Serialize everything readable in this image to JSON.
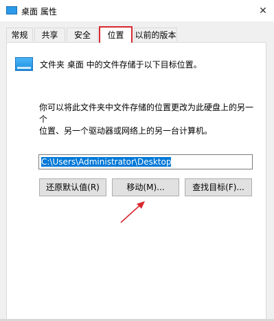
{
  "window": {
    "title": "桌面 属性",
    "close_glyph": "✕"
  },
  "tabs": [
    {
      "label": "常规",
      "active": false
    },
    {
      "label": "共享",
      "active": false
    },
    {
      "label": "安全",
      "active": false
    },
    {
      "label": "位置",
      "active": true
    },
    {
      "label": "以前的版本",
      "active": false
    }
  ],
  "panel": {
    "info": "文件夹 桌面 中的文件存储于以下目标位置。",
    "desc_line1": "你可以将此文件夹中文件存储的位置更改为此硬盘上的另一个",
    "desc_line2": "位置、另一个驱动器或网络上的另一台计算机。",
    "path_value": "C:\\Users\\Administrator\\Desktop",
    "buttons": {
      "restore": "还原默认值(R)",
      "move": "移动(M)...",
      "find_target": "查找目标(F)..."
    }
  },
  "colors": {
    "highlight": "#d8262d",
    "selection": "#0078d7",
    "folder": "#2b9ae8"
  },
  "icons": {
    "title": "folder-icon",
    "location": "folder-icon",
    "annotation": "arrow-icon"
  }
}
